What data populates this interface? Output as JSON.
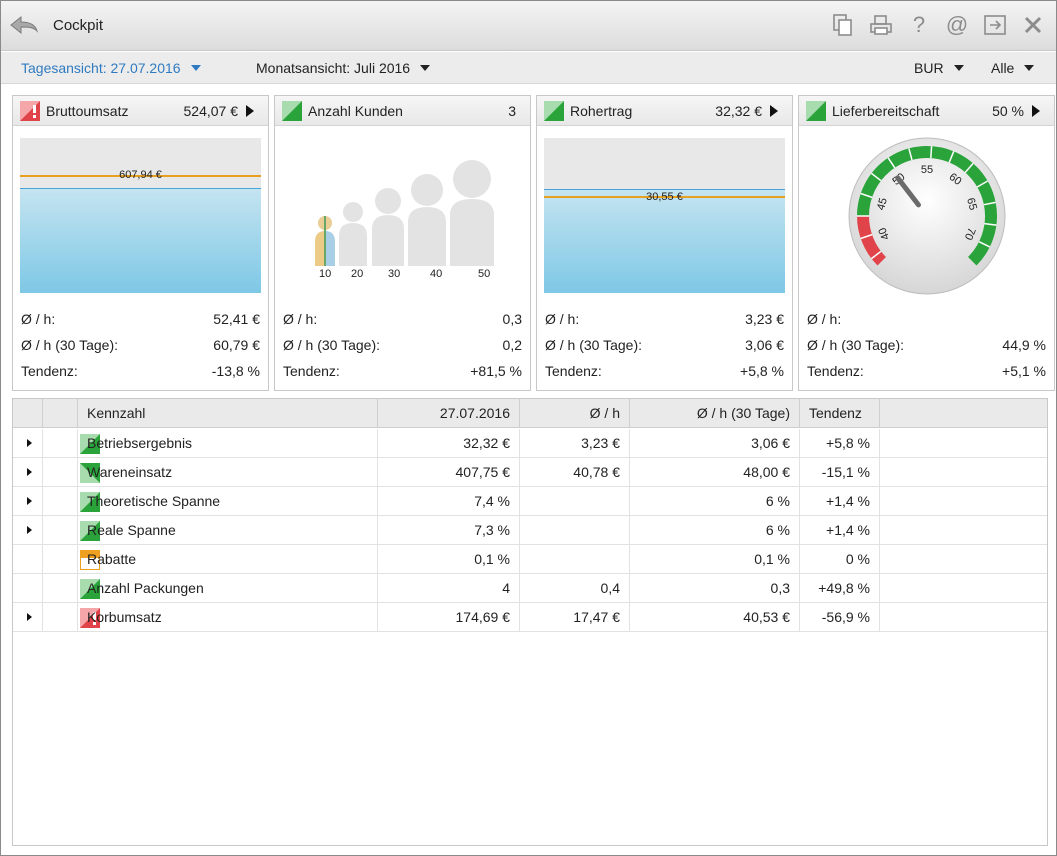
{
  "window": {
    "title": "Cockpit"
  },
  "toolbar": {
    "day_view": "Tagesansicht: 27.07.2016",
    "month_view": "Monatsansicht: Juli 2016",
    "branch": "BUR",
    "filter": "Alle"
  },
  "labels": {
    "avg_h": "Ø / h:",
    "avg_h_30": "Ø / h (30 Tage):",
    "trend": "Tendenz:"
  },
  "cards": [
    {
      "title": "Bruttoumsatz",
      "value": "524,07 €",
      "status": "alert",
      "avg_h": "52,41 €",
      "avg_h_30": "60,79 €",
      "trend": "-13,8 %",
      "ref_label": "607,94 €"
    },
    {
      "title": "Anzahl Kunden",
      "value": "3",
      "status": "good",
      "avg_h": "0,3",
      "avg_h_30": "0,2",
      "trend": "+81,5 %",
      "scale": [
        "10",
        "20",
        "30",
        "40",
        "50"
      ]
    },
    {
      "title": "Rohertrag",
      "value": "32,32 €",
      "status": "good",
      "avg_h": "3,23 €",
      "avg_h_30": "3,06 €",
      "trend": "+5,8 %",
      "ref_label": "30,55 €"
    },
    {
      "title": "Lieferbereitschaft",
      "value": "50 %",
      "status": "good",
      "avg_h": "",
      "avg_h_30": "44,9 %",
      "trend": "+5,1 %",
      "gauge": {
        "value": 50,
        "ticks": [
          "40",
          "45",
          "50",
          "55",
          "60",
          "65",
          "70"
        ]
      }
    }
  ],
  "table": {
    "headers": {
      "kennzahl": "Kennzahl",
      "date": "27.07.2016",
      "avg_h": "Ø / h",
      "avg_h_30": "Ø / h (30 Tage)",
      "trend": "Tendenz"
    },
    "rows": [
      {
        "expandable": true,
        "status": "good",
        "name": "Betriebsergebnis",
        "date": "32,32 €",
        "avg_h": "3,23 €",
        "avg_h_30": "3,06 €",
        "trend": "+5,8 %"
      },
      {
        "expandable": true,
        "status": "good-down",
        "name": "Wareneinsatz",
        "date": "407,75 €",
        "avg_h": "40,78 €",
        "avg_h_30": "48,00 €",
        "trend": "-15,1 %"
      },
      {
        "expandable": true,
        "status": "good",
        "name": "Theoretische Spanne",
        "date": "7,4 %",
        "avg_h": "",
        "avg_h_30": "6 %",
        "trend": "+1,4 %"
      },
      {
        "expandable": true,
        "status": "good",
        "name": "Reale Spanne",
        "date": "7,3 %",
        "avg_h": "",
        "avg_h_30": "6 %",
        "trend": "+1,4 %"
      },
      {
        "expandable": false,
        "status": "neutral",
        "name": "Rabatte",
        "date": "0,1 %",
        "avg_h": "",
        "avg_h_30": "0,1 %",
        "trend": "0 %"
      },
      {
        "expandable": false,
        "status": "good",
        "name": "Anzahl Packungen",
        "date": "4",
        "avg_h": "0,4",
        "avg_h_30": "0,3",
        "trend": "+49,8 %"
      },
      {
        "expandable": true,
        "status": "alert",
        "name": "Korbumsatz",
        "date": "174,69 €",
        "avg_h": "17,47 €",
        "avg_h_30": "40,53 €",
        "trend": "-56,9 %"
      }
    ]
  },
  "colors": {
    "good": "#2aa43a",
    "alert": "#e0444a",
    "neutral": "#f0a020",
    "accent": "#2f7bc1"
  }
}
